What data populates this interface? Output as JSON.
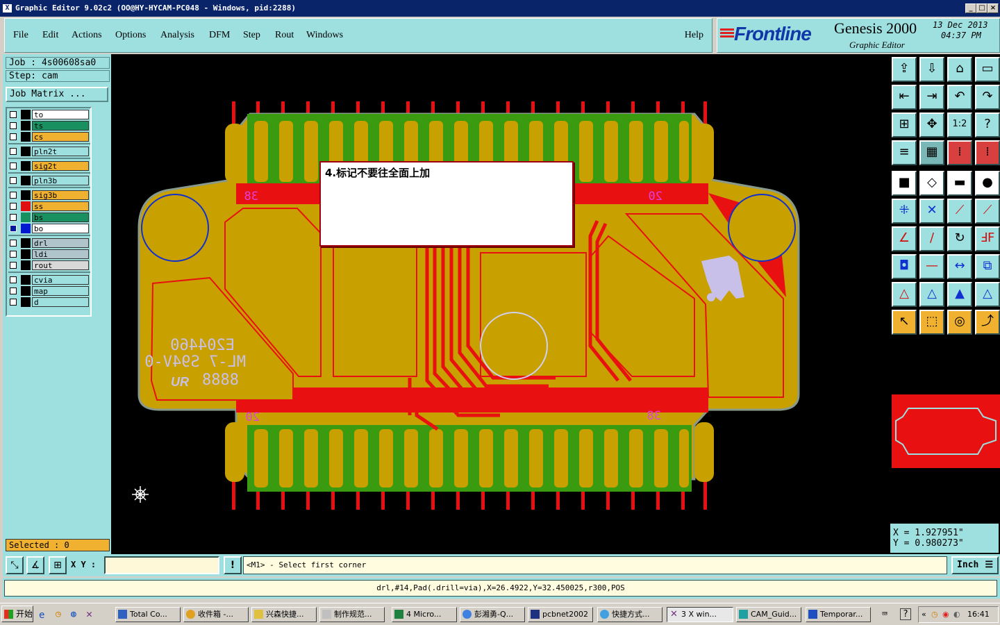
{
  "window": {
    "title": "Graphic Editor 9.02c2  (OO@HY-HYCAM-PC048 - Windows, pid:2288)",
    "app_icon": "X",
    "controls": [
      "_",
      "□",
      "×"
    ]
  },
  "menu": {
    "items": [
      "File",
      "Edit",
      "Actions",
      "Options",
      "Analysis",
      "DFM",
      "Step",
      "Rout",
      "Windows"
    ],
    "help": "Help"
  },
  "brand": {
    "logo": "Frontline",
    "product": "Genesis 2000",
    "subtitle": "Graphic Editor",
    "date_line1": "13 Dec 2013",
    "date_line2": "04:37 PM"
  },
  "job": {
    "job_line": "Job : 4s00608sa0",
    "step_line": "Step: cam",
    "matrix_button": "Job Matrix ..."
  },
  "layers": [
    {
      "name": "to",
      "color": "#ffffff",
      "checked": false,
      "group": 1
    },
    {
      "name": "ts",
      "color": "#189060",
      "checked": false,
      "group": 1
    },
    {
      "name": "cs",
      "color": "#f0b030",
      "checked": false,
      "group": 1
    },
    {
      "name": "pln2t",
      "color": "#9ee0e0",
      "checked": false,
      "group": 2
    },
    {
      "name": "sig2t",
      "color": "#f0b030",
      "checked": false,
      "group": 3
    },
    {
      "name": "pln3b",
      "color": "#9ee0e0",
      "checked": false,
      "group": 4
    },
    {
      "name": "sig3b",
      "color": "#f0b030",
      "checked": false,
      "group": 5
    },
    {
      "name": "ss",
      "color": "#f0b030",
      "checked": false,
      "swatch": "#e01010",
      "group": 5
    },
    {
      "name": "bs",
      "color": "#189060",
      "checked": false,
      "swatch": "#189060",
      "group": 5
    },
    {
      "name": "bo",
      "color": "#ffffff",
      "checked": true,
      "swatch": "#0018d0",
      "group": 5
    },
    {
      "name": "drl",
      "color": "#b0c4cc",
      "checked": false,
      "group": 6
    },
    {
      "name": "ldi",
      "color": "#b0c4cc",
      "checked": false,
      "group": 6
    },
    {
      "name": "rout",
      "color": "#d8d8d8",
      "checked": false,
      "group": 6
    },
    {
      "name": "cvia",
      "color": "#9ee0e0",
      "checked": false,
      "group": 7
    },
    {
      "name": "map",
      "color": "#9ee0e0",
      "checked": false,
      "group": 7
    },
    {
      "name": "d",
      "color": "#9ee0e0",
      "checked": false,
      "group": 7
    }
  ],
  "selected_label": "Selected : 0",
  "board": {
    "note": "4.标记不要往全面上加",
    "labels": [
      "38",
      "20",
      "20",
      "38"
    ],
    "silk_line1": "E204460",
    "silk_line2": "ML-7 S94V-0",
    "silk_line3": "8888",
    "silk_logo": "UR"
  },
  "coords": {
    "x": "X = 1.927951\"",
    "y": "Y = 0.980273\""
  },
  "command": {
    "xy_label": "X Y :",
    "xy_value": "",
    "prompt": "<M1> - Select first corner",
    "units": "Inch",
    "exclaim": "!"
  },
  "status": "drl,#14,Pad(.drill=via),X=26.4922,Y=32.450025,r300,POS",
  "taskbar": {
    "start": "开始",
    "tasks": [
      "Total Co...",
      "收件箱 -...",
      "兴森快捷...",
      "制作规范...",
      "4 Micro...",
      "彭湘勇-Q...",
      "pcbnet2002",
      "快捷方式...",
      "3 X win...",
      "CAM_Guid...",
      "Temporar..."
    ],
    "clock": "16:41"
  },
  "toolbar_icons": [
    [
      "open-icon",
      "save-icon",
      "home-icon",
      "window-icon"
    ],
    [
      "import-icon",
      "export-icon",
      "undo-icon",
      "redo-icon"
    ],
    [
      "zoom-fit-icon",
      "zoom-home-icon",
      "zoom-1to1-icon",
      "help-icon"
    ],
    [
      "settings-icon",
      "grid-icon",
      "layer-view-icon",
      "layer-edit-icon"
    ],
    [
      "fill-icon",
      "outline-icon",
      "ruler-icon",
      "pad-icon"
    ],
    [
      "connect-icon",
      "delete-icon",
      "line-icon",
      "pin-icon"
    ],
    [
      "angle-icon",
      "slash-icon",
      "arc-icon",
      "flip-icon"
    ],
    [
      "node-icon",
      "minus-icon",
      "measure-icon",
      "group-icon"
    ],
    [
      "tri-red-icon",
      "tri-blue-icon",
      "tri-up-icon",
      "tri-tools-icon"
    ],
    [
      "select-icon",
      "select-box-icon",
      "select-circle-icon",
      "select-path-icon"
    ]
  ]
}
